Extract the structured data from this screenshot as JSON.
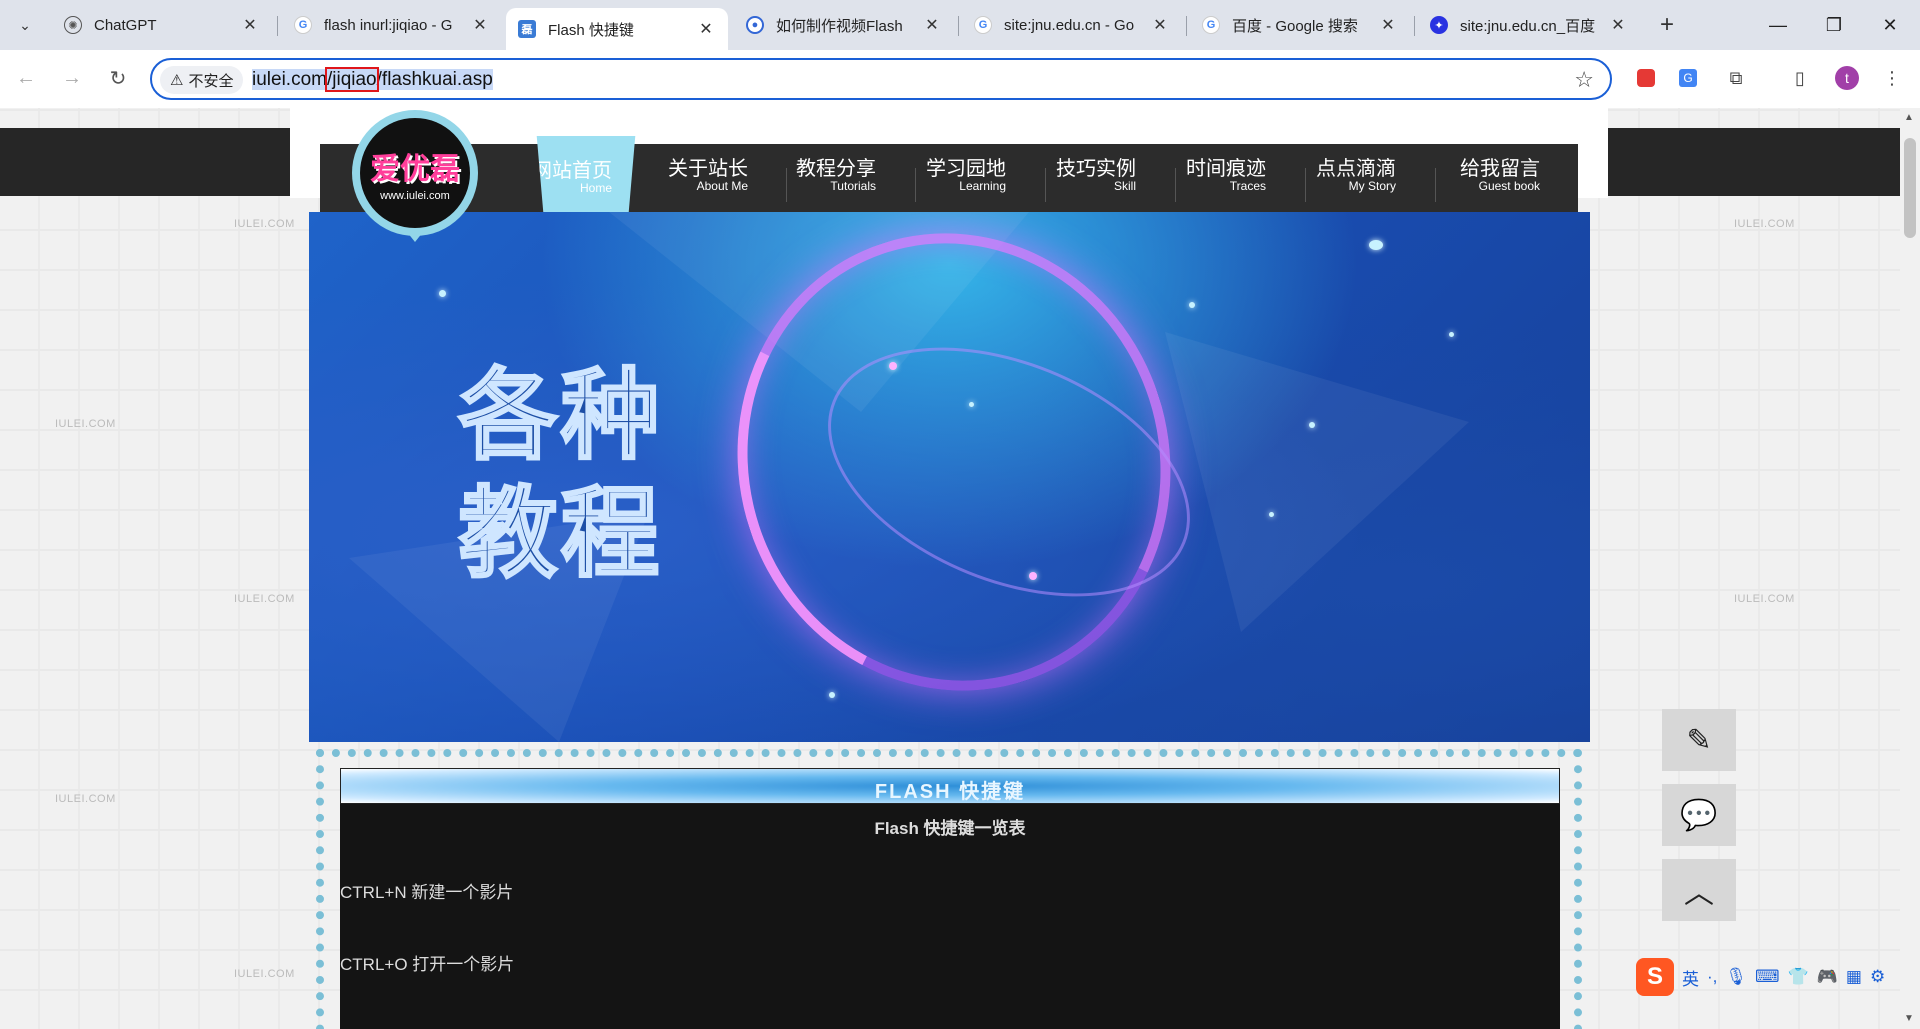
{
  "browser": {
    "tabs": [
      {
        "title": "ChatGPT",
        "icon": "chatgpt-icon",
        "active": false
      },
      {
        "title": "flash inurl:jiqiao - G",
        "icon": "google-icon",
        "active": false
      },
      {
        "title": "Flash 快捷键",
        "icon": "site-icon",
        "active": true
      },
      {
        "title": "如何制作视频Flash",
        "icon": "chrome-icon",
        "active": false
      },
      {
        "title": "site:jnu.edu.cn - Go",
        "icon": "google-icon",
        "active": false
      },
      {
        "title": "百度 - Google 搜索",
        "icon": "google-icon",
        "active": false
      },
      {
        "title": "site:jnu.edu.cn_百度",
        "icon": "baidu-icon",
        "active": false
      }
    ],
    "security_chip": "不安全",
    "url": {
      "prefix": "iulei.com",
      "highlight": "/jiqiao",
      "suffix": "/flashkuai.asp"
    },
    "profile_letter": "t"
  },
  "site": {
    "logo": {
      "cn": "爱优磊",
      "en": "www.iulei.com"
    },
    "watermark": "IULEI.COM",
    "nav": [
      {
        "cn": "网站首页",
        "en": "Home"
      },
      {
        "cn": "关于站长",
        "en": "About Me"
      },
      {
        "cn": "教程分享",
        "en": "Tutorials"
      },
      {
        "cn": "学习园地",
        "en": "Learning"
      },
      {
        "cn": "技巧实例",
        "en": "Skill"
      },
      {
        "cn": "时间痕迹",
        "en": "Traces"
      },
      {
        "cn": "点点滴滴",
        "en": "My Story"
      },
      {
        "cn": "给我留言",
        "en": "Guest book"
      }
    ],
    "banner_text": [
      "各种",
      "教程"
    ],
    "content": {
      "header": "FLASH 快捷键",
      "subtitle": "Flash 快捷键一览表",
      "lines": [
        "CTRL+N 新建一个影片",
        "CTRL+O 打开一个影片"
      ]
    }
  },
  "ime": {
    "lang": "英"
  }
}
